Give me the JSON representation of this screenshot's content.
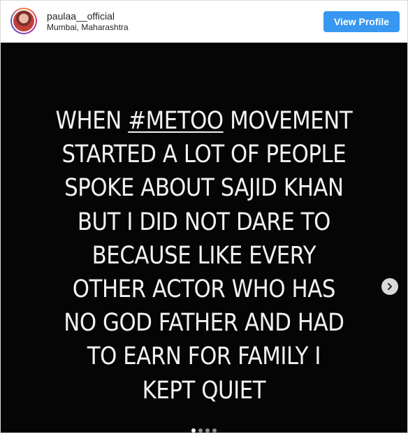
{
  "header": {
    "username": "paulaa__official",
    "location": "Mumbai, Maharashtra",
    "view_profile_label": "View Profile"
  },
  "post": {
    "lines": [
      {
        "before": "WHEN ",
        "hashtag": "#METOO",
        "after": " MOVEMENT"
      },
      "STARTED A LOT OF PEOPLE",
      "SPOKE ABOUT SAJID KHAN",
      "BUT I DID NOT DARE TO",
      "BECAUSE LIKE EVERY",
      "OTHER ACTOR WHO HAS",
      "NO GOD FATHER AND HAD",
      "TO EARN FOR FAMILY I",
      "KEPT QUIET"
    ],
    "background": "#050505",
    "text_color": "#f2f2f2"
  },
  "carousel": {
    "slide_count": 4,
    "active_index": 0,
    "next_icon": "chevron-right-icon"
  },
  "colors": {
    "button_blue": "#3897f0"
  }
}
